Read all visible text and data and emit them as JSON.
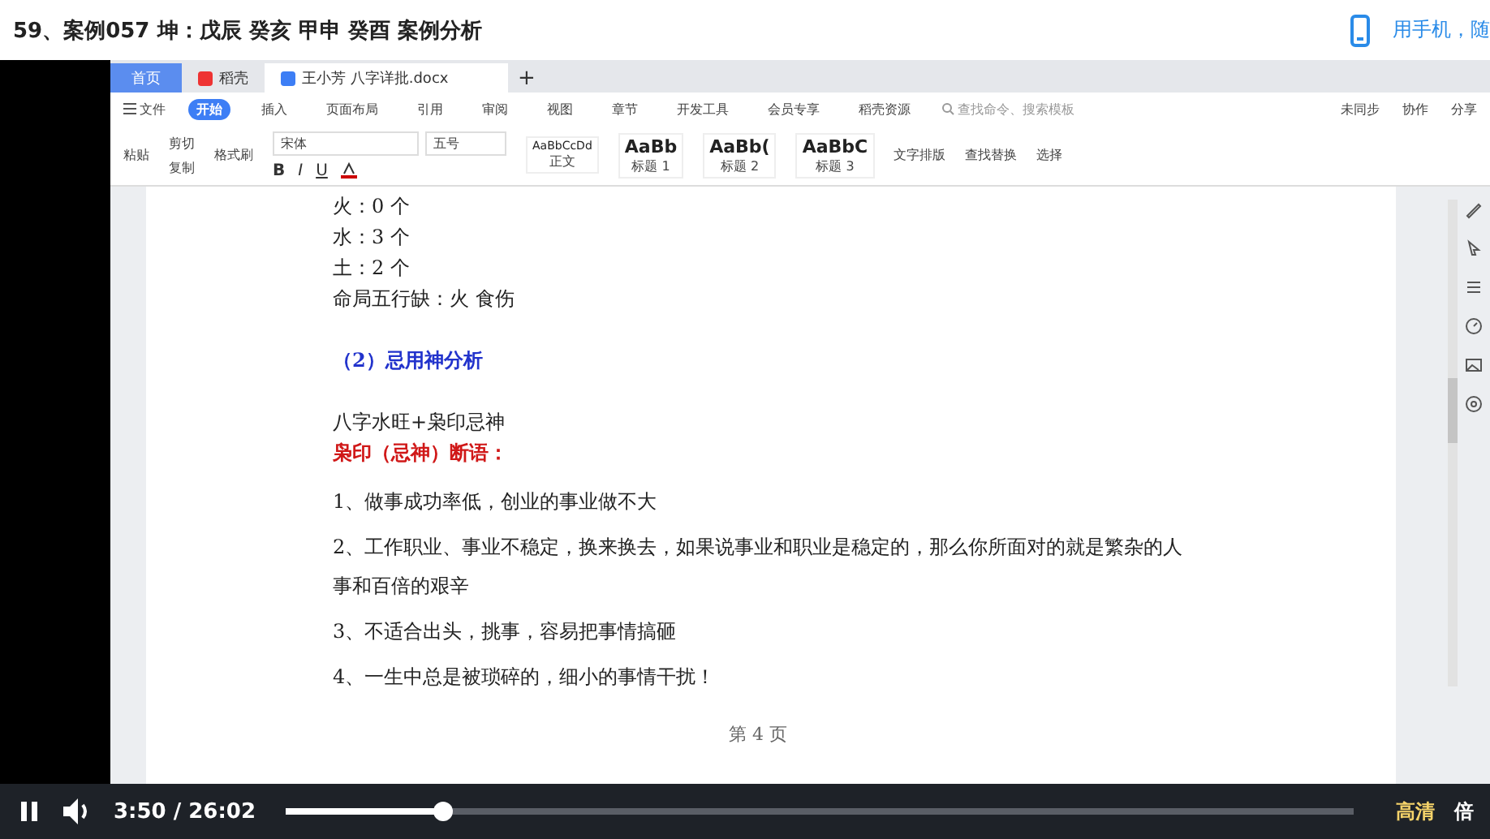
{
  "header": {
    "title": "59、案例057 坤：戊辰 癸亥 甲申 癸酉 案例分析",
    "mobile_link": "用手机，随"
  },
  "app_tabs": [
    {
      "label": "首页",
      "kind": "home",
      "selected": false
    },
    {
      "label": "稻壳",
      "kind": "docer",
      "selected": false
    },
    {
      "label": "王小芳 八字详批.docx",
      "kind": "doc",
      "selected": true
    },
    {
      "label": "+",
      "kind": "add",
      "selected": false
    }
  ],
  "menu": {
    "file": "文件",
    "tabs": [
      {
        "label": "开始",
        "selected": true
      },
      {
        "label": "插入",
        "selected": false
      },
      {
        "label": "页面布局",
        "selected": false
      },
      {
        "label": "引用",
        "selected": false
      },
      {
        "label": "审阅",
        "selected": false
      },
      {
        "label": "视图",
        "selected": false
      },
      {
        "label": "章节",
        "selected": false
      },
      {
        "label": "开发工具",
        "selected": false
      },
      {
        "label": "会员专享",
        "selected": false
      },
      {
        "label": "稻壳资源",
        "selected": false
      }
    ],
    "search": {
      "placeholder": "查找命令、搜索模板"
    },
    "actions": [
      "未同步",
      "协作",
      "分享"
    ]
  },
  "ribbon": {
    "paste": "粘贴",
    "cut": "剪切",
    "copy": "复制",
    "format_painter": "格式刷",
    "format_buttons": [
      {
        "label": "B",
        "kind": "bold"
      },
      {
        "label": "I",
        "kind": "italic"
      },
      {
        "label": "U",
        "kind": "underline"
      }
    ],
    "font": "宋体",
    "size": "五号",
    "styles": [
      {
        "sample": "AaBbCcDd",
        "label": "正文"
      },
      {
        "sample": "AaBb",
        "label": "标题 1"
      },
      {
        "sample": "AaBb(",
        "label": "标题 2"
      },
      {
        "sample": "AaBbC",
        "label": "标题 3"
      }
    ],
    "tools": [
      "文字排版",
      "查找替换",
      "选择"
    ]
  },
  "document": {
    "lines": [
      {
        "kind": "normal",
        "text": "火：0 个"
      },
      {
        "kind": "normal",
        "text": "水：3 个"
      },
      {
        "kind": "normal",
        "text": "土：2 个"
      },
      {
        "kind": "normal",
        "text": "命局五行缺：火 食伤"
      },
      {
        "kind": "heading",
        "text": "（2）忌用神分析"
      },
      {
        "kind": "normal",
        "text": "八字水旺+枭印忌神"
      },
      {
        "kind": "red",
        "text": "枭印（忌神）断语："
      },
      {
        "kind": "item",
        "text": "1、做事成功率低，创业的事业做不大"
      },
      {
        "kind": "item",
        "text": "2、工作职业、事业不稳定，换来换去，如果说事业和职业是稳定的，那么你所面对的就是繁杂的人事和百倍的艰辛"
      },
      {
        "kind": "item",
        "text": "3、不适合出头，挑事，容易把事情搞砸"
      },
      {
        "kind": "item",
        "text": "4、一生中总是被琐碎的，细小的事情干扰！"
      }
    ],
    "page_footer": "第 4 页"
  },
  "player": {
    "playing": true,
    "time": "3:50 / 26:02",
    "level": 0.148,
    "quality": "高清",
    "speed": "倍"
  }
}
